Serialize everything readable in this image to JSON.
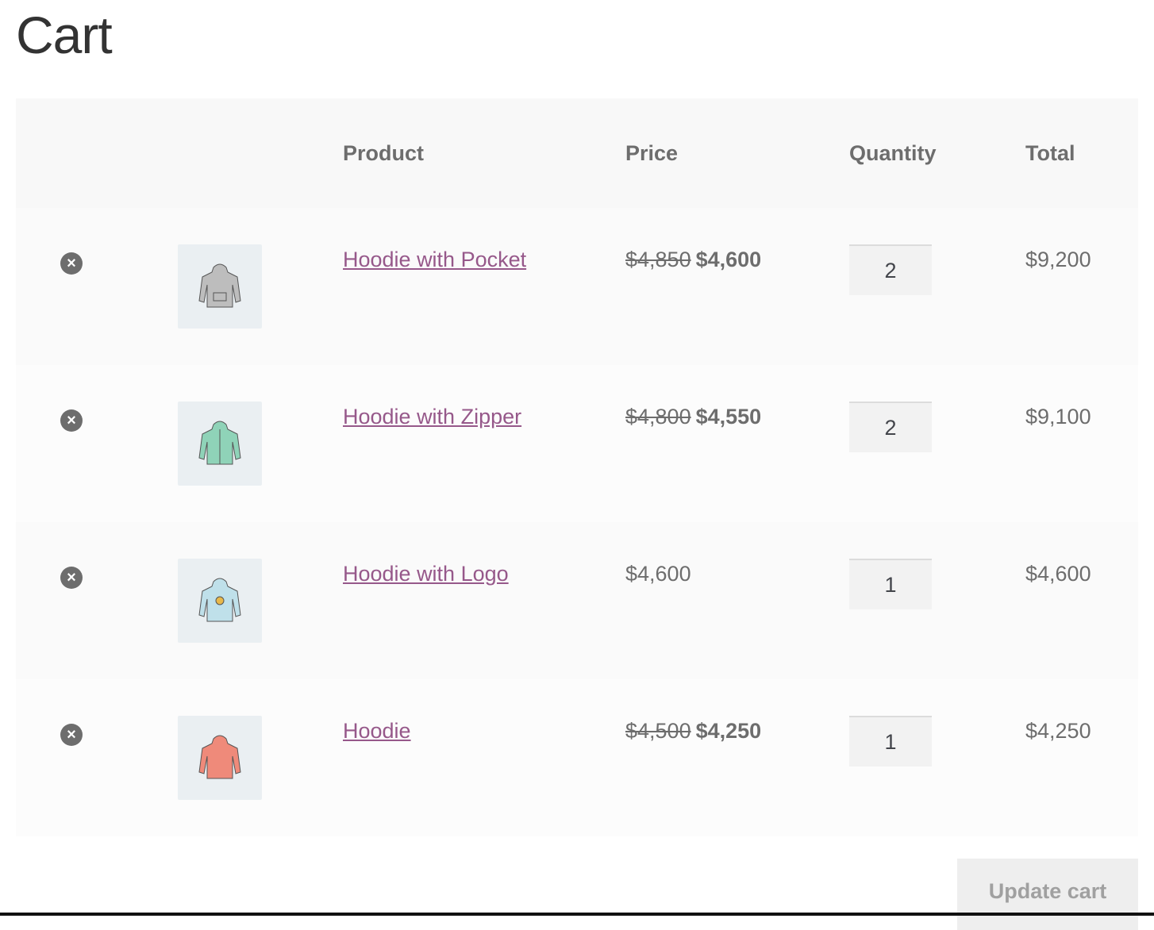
{
  "page": {
    "title": "Cart"
  },
  "table": {
    "headers": {
      "product": "Product",
      "price": "Price",
      "quantity": "Quantity",
      "total": "Total"
    },
    "rows": [
      {
        "name": "Hoodie with Pocket",
        "old_price": "$4,850",
        "price": "$4,600",
        "quantity": "2",
        "total": "$9,200",
        "image_color": "#bdbdbd"
      },
      {
        "name": "Hoodie with Zipper",
        "old_price": "$4,800",
        "price": "$4,550",
        "quantity": "2",
        "total": "$9,100",
        "image_color": "#8fd3b8"
      },
      {
        "name": "Hoodie with Logo",
        "old_price": "",
        "price": "$4,600",
        "quantity": "1",
        "total": "$4,600",
        "image_color": "#bfe0ea"
      },
      {
        "name": "Hoodie",
        "old_price": "$4,500",
        "price": "$4,250",
        "quantity": "1",
        "total": "$4,250",
        "image_color": "#ef8a7a"
      }
    ]
  },
  "actions": {
    "update_cart": "Update cart"
  },
  "icons": {
    "remove": "remove-circle-icon",
    "thumbnail": "hoodie-thumbnail"
  },
  "colors": {
    "link": "#96588a",
    "text": "#6d6d6d",
    "header_bg": "#f8f8f8"
  }
}
